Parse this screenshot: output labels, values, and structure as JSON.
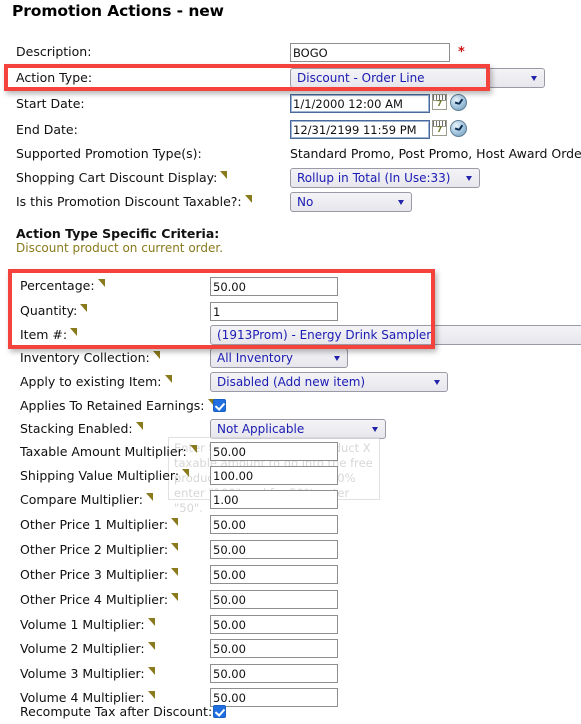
{
  "page": {
    "title_main": "Promotion Actions",
    "title_sep": " - ",
    "title_state": "new"
  },
  "form": {
    "description": {
      "label": "Description:",
      "value": "BOGO",
      "required_mark": "*"
    },
    "action_type": {
      "label": "Action Type:",
      "value": "Discount - Order Line"
    },
    "start_date": {
      "label": "Start Date:",
      "value": "1/1/2000 12:00 AM",
      "calendar_icon_day": "7",
      "calendar_icon": "calendar-icon",
      "clock_icon": "clock-icon"
    },
    "end_date": {
      "label": "End Date:",
      "value": "12/31/2199 11:59 PM",
      "calendar_icon_day": "7",
      "calendar_icon": "calendar-icon",
      "clock_icon": "clock-icon"
    },
    "supported_promotion_types": {
      "label": "Supported Promotion Type(s):",
      "value": "Standard Promo, Post Promo, Host Award Order"
    },
    "cart_discount_display": {
      "label": "Shopping Cart Discount Display:",
      "value": "Rollup in Total (In Use:33)"
    },
    "discount_taxable": {
      "label": "Is this Promotion Discount Taxable?:",
      "value": "No"
    }
  },
  "criteria_section": {
    "heading": "Action Type Specific Criteria:",
    "subheading": "Discount product on current order.",
    "percentage": {
      "label": "Percentage:",
      "value": "50.00"
    },
    "quantity": {
      "label": "Quantity:",
      "value": "1"
    },
    "item_number": {
      "label": "Item #:",
      "value": "(1913Prom) - Energy Drink Sampler"
    },
    "inventory_collection": {
      "label": "Inventory Collection:",
      "value": "All Inventory"
    },
    "apply_existing_item": {
      "label": "Apply to existing Item:",
      "value": "Disabled (Add new item)"
    },
    "retained_earnings": {
      "label": "Applies To Retained Earnings:",
      "checked": true
    },
    "stacking_enabled": {
      "label": "Stacking Enabled:",
      "value": "Not Applicable"
    },
    "taxable_amount_multiplier": {
      "label": "Taxable Amount Multiplier:",
      "value": "50.00"
    },
    "shipping_value_multiplier": {
      "label": "Shipping Value Multiplier:",
      "value": "100.00"
    },
    "compare_multiplier": {
      "label": "Compare Multiplier:",
      "value": "1.00"
    },
    "other_price_1_multiplier": {
      "label": "Other Price 1 Multiplier:",
      "value": "50.00"
    },
    "other_price_2_multiplier": {
      "label": "Other Price 2 Multiplier:",
      "value": "50.00"
    },
    "other_price_3_multiplier": {
      "label": "Other Price 3 Multiplier:",
      "value": "50.00"
    },
    "other_price_4_multiplier": {
      "label": "Other Price 4 Multiplier:",
      "value": "50.00"
    },
    "volume_1_multiplier": {
      "label": "Volume 1 Multiplier:",
      "value": "50.00"
    },
    "volume_2_multiplier": {
      "label": "Volume 2 Multiplier:",
      "value": "50.00"
    },
    "volume_3_multiplier": {
      "label": "Volume 3 Multiplier:",
      "value": "50.00"
    },
    "volume_4_multiplier": {
      "label": "Volume 4 Multiplier:",
      "value": "50.00"
    },
    "recompute_tax": {
      "label": "Recompute Tax after Discount:",
      "checked": true
    }
  },
  "tooltip_ghost": {
    "text": "Enter the percentage of product X taxable amount to go into the free product. For instance, for 100% enter \"100\" and for 50% enter \"50\"."
  },
  "annotations": {
    "highlight_1_target": "action-type-row",
    "highlight_2_target": "criteria-percentage-quantity-item-group",
    "highlight_color": "#f4423c"
  }
}
